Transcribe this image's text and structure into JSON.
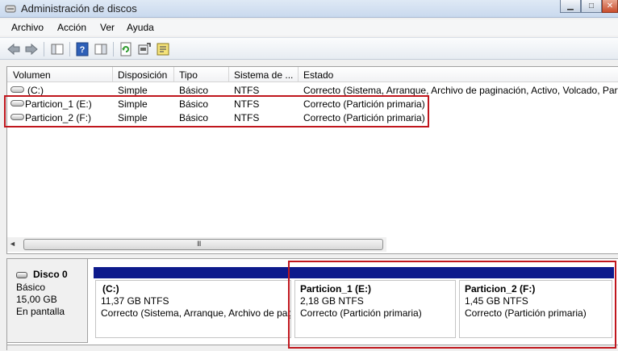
{
  "window": {
    "title": "Administración de discos"
  },
  "menu": [
    "Archivo",
    "Acción",
    "Ver",
    "Ayuda"
  ],
  "toolbar_icons": [
    "back-arrow-icon",
    "forward-arrow-icon",
    "console-tree-icon",
    "help-icon",
    "properties-pane-icon",
    "refresh-icon",
    "rescan-icon",
    "properties-icon"
  ],
  "table": {
    "columns": [
      "Volumen",
      "Disposición",
      "Tipo",
      "Sistema de ...",
      "Estado"
    ],
    "rows": [
      {
        "volumen": "(C:)",
        "disposicion": "Simple",
        "tipo": "Básico",
        "sistema": "NTFS",
        "estado": "Correcto (Sistema, Arranque, Archivo de paginación, Activo, Volcado, Part"
      },
      {
        "volumen": "Particion_1 (E:)",
        "disposicion": "Simple",
        "tipo": "Básico",
        "sistema": "NTFS",
        "estado": "Correcto (Partición primaria)"
      },
      {
        "volumen": "Particion_2 (F:)",
        "disposicion": "Simple",
        "tipo": "Básico",
        "sistema": "NTFS",
        "estado": "Correcto (Partición primaria)"
      }
    ],
    "scroll_grip": "III"
  },
  "disk": {
    "name": "Disco 0",
    "type": "Básico",
    "size": "15,00 GB",
    "status": "En pantalla",
    "partitions": [
      {
        "label": "(C:)",
        "size": "11,37 GB NTFS",
        "status": "Correcto (Sistema, Arranque, Archivo de pag"
      },
      {
        "label": "Particion_1  (E:)",
        "size": "2,18 GB NTFS",
        "status": "Correcto (Partición primaria)"
      },
      {
        "label": "Particion_2  (F:)",
        "size": "1,45 GB NTFS",
        "status": "Correcto (Partición primaria)"
      }
    ]
  },
  "colors": {
    "partition_bar": "#0d1a8c",
    "highlight": "#c0161d"
  }
}
